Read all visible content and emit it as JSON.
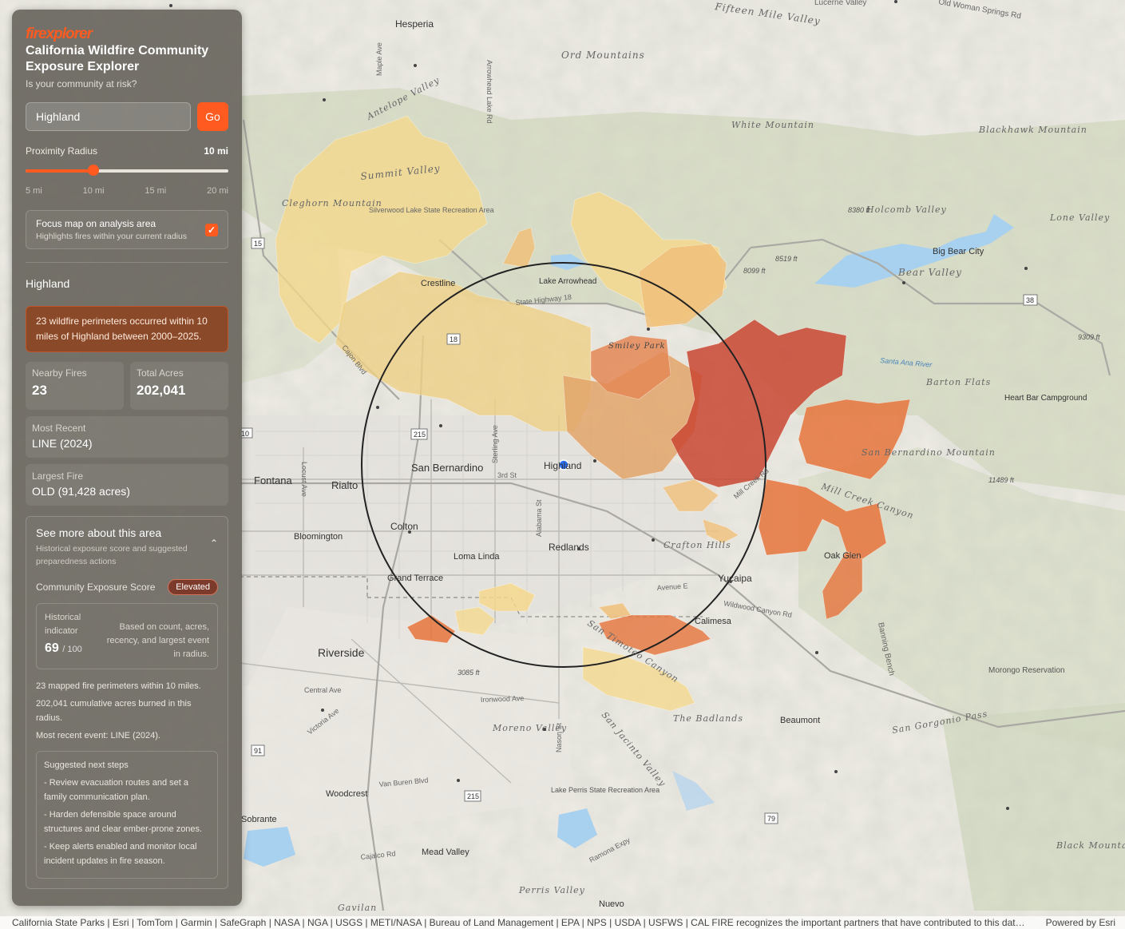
{
  "app": {
    "brand": "firexplorer",
    "title": "California Wildfire Community Exposure Explorer",
    "subtitle": "Is your community at risk?"
  },
  "search": {
    "value": "Highland",
    "go_label": "Go"
  },
  "radius": {
    "label": "Proximity Radius",
    "value_label": "10 mi",
    "value_fraction": 0.333,
    "ticks": [
      "5 mi",
      "10 mi",
      "15 mi",
      "20 mi"
    ]
  },
  "focus": {
    "title": "Focus map on analysis area",
    "subtitle": "Highlights fires within your current radius",
    "checked": true
  },
  "place": "Highland",
  "alert": "23 wildfire perimeters occurred within 10 miles of Highland between 2000–2025.",
  "stats": {
    "nearby_label": "Nearby Fires",
    "nearby_value": "23",
    "acres_label": "Total Acres",
    "acres_value": "202,041",
    "recent_label": "Most Recent",
    "recent_value": "LINE (2024)",
    "largest_label": "Largest Fire",
    "largest_value": "OLD (91,428 acres)"
  },
  "more": {
    "title": "See more about this area",
    "subtitle": "Historical exposure score and suggested preparedness actions",
    "score_label": "Community Exposure Score",
    "score_badge": "Elevated",
    "hist_label_1": "Historical",
    "hist_label_2": "indicator",
    "hist_score": "69",
    "hist_of": "/ 100",
    "hist_note": "Based on count, acres, recency, and largest event in radius.",
    "facts": [
      "23 mapped fire perimeters within 10 miles.",
      "202,041 cumulative acres burned in this radius.",
      "Most recent event: LINE (2024)."
    ],
    "steps_title": "Suggested next steps",
    "steps": [
      "- Review evacuation routes and set a family communication plan.",
      "- Harden defensible space around structures and clear ember-prone zones.",
      "- Keep alerts enabled and monitor local incident updates in fire season."
    ]
  },
  "attribution": {
    "text": "California State Parks | Esri | TomTom | Garmin | SafeGraph | NASA | NGA | USGS | METI/NASA | Bureau of Land Management | EPA | NPS | USDA | USFWS | CAL FIRE recognizes the important partners that have contributed to this dataset, i...",
    "powered": "Powered by Esri"
  },
  "map_labels": {
    "cities": [
      "Hesperia",
      "San Bernardino",
      "Highland",
      "Fontana",
      "Rialto",
      "Colton",
      "Redlands",
      "Loma Linda",
      "Grand Terrace",
      "Riverside",
      "Yucaipa",
      "Calimesa",
      "Beaumont",
      "Crestline",
      "Lake Arrowhead",
      "Big Bear City",
      "Oak Glen",
      "Bloomington",
      "Woodcrest",
      "Sobrante",
      "Mead Valley",
      "Nuevo",
      "Perris Valley",
      "Moreno Valley",
      "Heart Bar Campground",
      "Morongo Reservation",
      "Lake Perris State Recreation Area",
      "Silverwood Lake State Recreation Area"
    ],
    "terrain": [
      "Fifteen Mile Valley",
      "Ord Mountains",
      "White Mountain",
      "Blackhawk Mountain",
      "Holcomb Valley",
      "Lone Valley",
      "Bear Valley",
      "Barton Flats",
      "San Bernardino Mountain",
      "Mill Creek Canyon",
      "Summit Valley",
      "Cleghorn Mountain",
      "Antelope Valley",
      "Smiley Park",
      "Crafton Hills",
      "San Timoteo Canyon",
      "San Jacinto Valley",
      "The Badlands",
      "San Gorgonio Pass",
      "Black Mountain",
      "Gavilan"
    ],
    "roads": [
      "State Highway 18",
      "Cajon Blvd",
      "Sterling Ave",
      "3rd St",
      "Alabama St",
      "Avenue E",
      "Wildwood Canyon Rd",
      "Mill Creek Rd",
      "Central Ave",
      "Victoria Ave",
      "Ironwood Ave",
      "Van Buren Blvd",
      "Cajalco Rd",
      "Ramona Expy",
      "Nason St",
      "Locust Ave",
      "Banning Bench",
      "Santa Ana River",
      "Arrowhead Lake Rd",
      "Maple Ave",
      "Old Woman Springs Rd",
      "Lucerne Valley"
    ],
    "elevations": [
      "8380 ft",
      "8519 ft",
      "8099 ft",
      "9309 ft",
      "11489 ft",
      "3085 ft"
    ],
    "shields": [
      "15",
      "215",
      "18",
      "38",
      "91",
      "79",
      "215",
      "10"
    ]
  },
  "colors": {
    "accent": "#ff5a1f",
    "fire_light": "#f6d889",
    "fire_mid": "#e9a060",
    "fire_orange": "#e6743c",
    "fire_red": "#c94632",
    "analysis_circle": "#222222",
    "location_dot": "#2b6ff2"
  }
}
